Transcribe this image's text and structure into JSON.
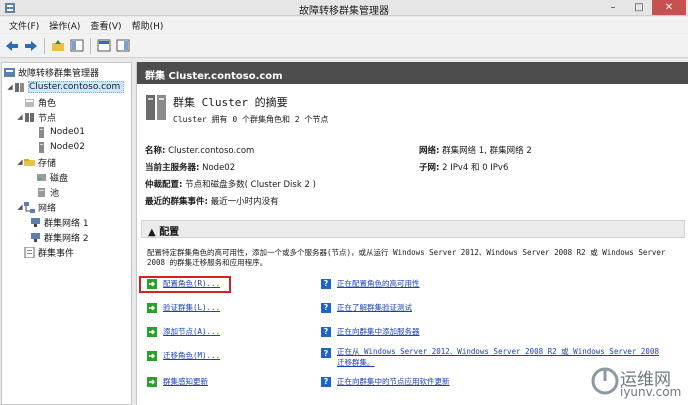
{
  "window": {
    "title": "故障转移群集管理器"
  },
  "menu": [
    "文件(F)",
    "操作(A)",
    "查看(V)",
    "帮助(H)"
  ],
  "tree": {
    "root": "故障转移群集管理器",
    "cluster": "Cluster.contoso.com",
    "roles": "角色",
    "nodes": "节点",
    "node1": "Node01",
    "node2": "Node02",
    "storage": "存储",
    "disks": "磁盘",
    "pools": "池",
    "networks": "网络",
    "net1": "群集网络 1",
    "net2": "群集网络 2",
    "events": "群集事件"
  },
  "main": {
    "header": "群集 Cluster.contoso.com",
    "summary_title": "群集 Cluster 的摘要",
    "summary_sub": "Cluster 拥有 0 个群集角色和 2 个节点",
    "info": {
      "name_label": "名称:",
      "name_value": "Cluster.contoso.com",
      "host_label": "当前主服务器:",
      "host_value": "Node02",
      "quorum_label": "仲裁配置:",
      "quorum_value": "节点和磁盘多数( Cluster Disk 2 )",
      "events_label": "最近的群集事件:",
      "events_value": "最近一小时内没有",
      "network_label": "网络:",
      "network_value": "群集网络 1, 群集网络 2",
      "subnet_label": "子网:",
      "subnet_value": "2 IPv4 和 0 IPv6"
    },
    "config_header": "配置",
    "config_desc": "配置特定群集角色的高可用性，添加一个或多个服务器(节点)，或从运行 Windows Server 2012、Windows Server 2008 R2 或 Windows Server 2008 的群集迁移服务和应用程序。",
    "actions_left": [
      "配置角色(R)...",
      "验证群集(L)...",
      "添加节点(A)...",
      "迁移角色(M)...",
      "群集感知更新"
    ],
    "actions_right": [
      "正在配置角色的高可用性",
      "正在了解群集验证测试",
      "正在向群集中添加服务器",
      "正在从 Windows Server 2012、Windows Server 2008 R2 或 Windows Server 2008 迁移群集。",
      "正在向群集中的节点应用软件更新"
    ]
  },
  "watermark": {
    "line1": "运维网",
    "line2": "iyunv.com"
  }
}
